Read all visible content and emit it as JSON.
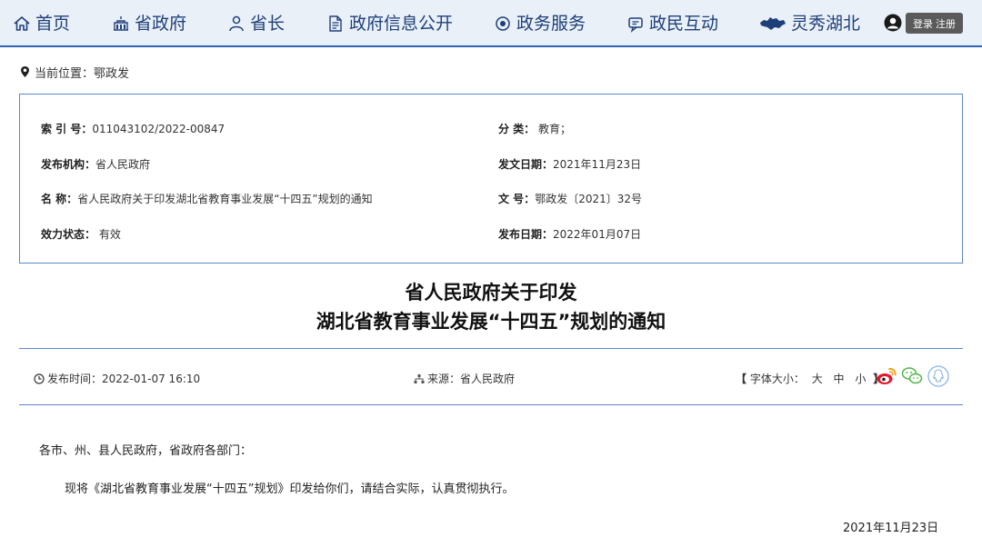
{
  "nav": {
    "items": [
      {
        "label": "首页",
        "icon": "home-icon"
      },
      {
        "label": "省政府",
        "icon": "government-building-icon"
      },
      {
        "label": "省长",
        "icon": "governor-person-icon"
      },
      {
        "label": "政府信息公开",
        "icon": "document-icon"
      },
      {
        "label": "政务服务",
        "icon": "service-icon"
      },
      {
        "label": "政民互动",
        "icon": "chat-icon"
      },
      {
        "label": "灵秀湖北",
        "icon": "hubei-map-icon"
      }
    ],
    "login_label": "登录",
    "register_label": "注册",
    "accent": "#2d64b3"
  },
  "breadcrumb": {
    "prefix": "当前位置：",
    "current": "鄂政发"
  },
  "info": {
    "index_label": "索 引 号：",
    "index_value": "011043102/2022-00847",
    "category_label": "分 类：",
    "category_value": " 教育；",
    "publisher_label": "发布机构：",
    "publisher_value": "省人民政府",
    "issue_date_label": "发文日期：",
    "issue_date_value": "2021年11月23日",
    "name_label": "名 称：",
    "name_value": "省人民政府关于印发湖北省教育事业发展“十四五”规划的通知",
    "doc_no_label": "文 号：",
    "doc_no_value": "鄂政发〔2021〕32号",
    "status_label": "效力状态：",
    "status_value": " 有效",
    "publish_date_label": "发布日期：",
    "publish_date_value": "2022年01月07日"
  },
  "title": {
    "line1": "省人民政府关于印发",
    "line2": "湖北省教育事业发展“十四五”规划的通知"
  },
  "meta": {
    "publish_time": "发布时间：2022-01-07 16:10",
    "source": "来源：省人民政府",
    "font_size_label": "字体大小：",
    "font_large": "大",
    "font_medium": "中",
    "font_small": "小",
    "bracket_open": "【",
    "bracket_close": "】"
  },
  "body": {
    "salutation": "各市、州、县人民政府，省政府各部门：",
    "paragraph1": "现将《湖北省教育事业发展“十四五”规划》印发给你们，请结合实际，认真贯彻执行。",
    "date": "2021年11月23日"
  }
}
